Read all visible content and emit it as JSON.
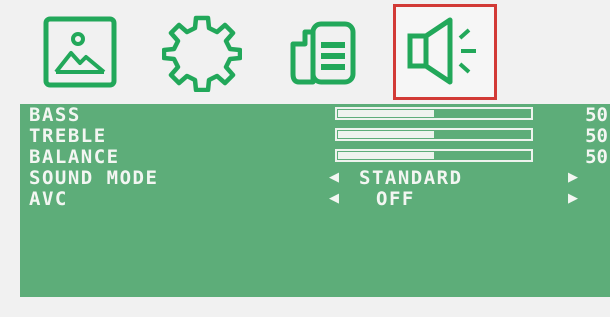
{
  "tabs": [
    {
      "icon": "picture-icon",
      "selected": false
    },
    {
      "icon": "gear-icon",
      "selected": false
    },
    {
      "icon": "document-icon",
      "selected": false
    },
    {
      "icon": "speaker-icon",
      "selected": true
    }
  ],
  "colors": {
    "accent": "#22a85a",
    "selection": "#d23a36",
    "panel": "#5dad79",
    "text": "#f3f6f2"
  },
  "sound_menu": {
    "bass": {
      "label": "BASS",
      "value": "50",
      "level": 0.5
    },
    "treble": {
      "label": "TREBLE",
      "value": "50",
      "level": 0.5
    },
    "balance": {
      "label": "BALANCE",
      "value": "50",
      "level": 0.5
    },
    "sound_mode": {
      "label": "SOUND MODE",
      "value": "STANDARD"
    },
    "avc": {
      "label": "AVC",
      "value": "OFF"
    }
  }
}
